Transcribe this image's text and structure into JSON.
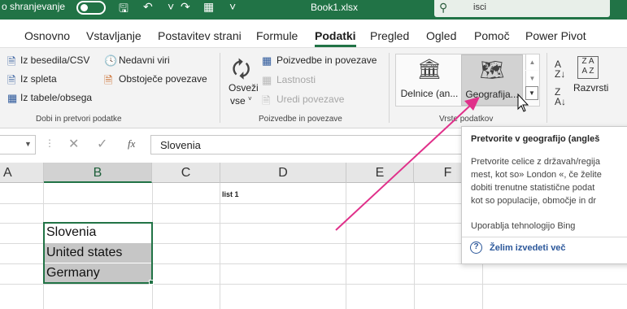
{
  "titlebar": {
    "autosave_label": "o shranjevanje",
    "doc_title": "Book1.xlsx",
    "search_text": "isci"
  },
  "tabs": [
    {
      "label": "Osnovno"
    },
    {
      "label": "Vstavljanje"
    },
    {
      "label": "Postavitev strani"
    },
    {
      "label": "Formule"
    },
    {
      "label": "Podatki",
      "active": true
    },
    {
      "label": "Pregled"
    },
    {
      "label": "Ogled"
    },
    {
      "label": "Pomoč"
    },
    {
      "label": "Power Pivot"
    }
  ],
  "ribbon": {
    "get_data": {
      "from_text_csv": "Iz besedila/CSV",
      "from_web": "Iz spleta",
      "from_table": "Iz tabele/obsega",
      "recent_sources": "Nedavni viri",
      "existing_connections": "Obstoječe povezave",
      "group_label": "Dobi in pretvori podatke"
    },
    "queries": {
      "refresh_line1": "Osveži",
      "refresh_line2": "vse",
      "queries_connections": "Poizvedbe in povezave",
      "properties": "Lastnosti",
      "edit_links": "Uredi povezave",
      "group_label": "Poizvedbe in povezave"
    },
    "data_types": {
      "stocks": "Delnice (an...",
      "geography": "Geografija...",
      "group_label": "Vrste podatkov"
    },
    "sort": {
      "label": "Razvrsti"
    }
  },
  "formula_bar": {
    "content": "Slovenia",
    "fx": "fx"
  },
  "grid": {
    "columns": [
      "A",
      "B",
      "C",
      "D",
      "E",
      "F"
    ],
    "label_d1": "list 1",
    "cells": [
      "Slovenia",
      "United states",
      "Germany"
    ]
  },
  "tooltip": {
    "title": "Pretvorite v geografijo  (angleš",
    "lines": [
      "Pretvorite celice z državah/regija",
      "mest, kot so» London «, če želite",
      "dobiti trenutne statistične podat",
      "kot so populacije, območje in dr"
    ],
    "bing": "Uporablja tehnologijo Bing",
    "help_icon": "?",
    "learn_more": "Želim izvedeti več"
  },
  "colors": {
    "excel_green": "#217346",
    "arrow_magenta": "#e0308a",
    "link_blue": "#2b579a"
  }
}
